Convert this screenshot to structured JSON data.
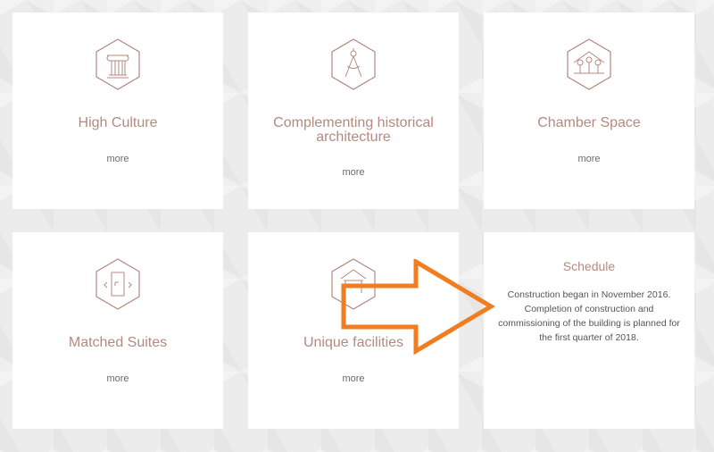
{
  "cards": [
    {
      "title": "High Culture",
      "more": "more",
      "icon": "column-icon"
    },
    {
      "title": "Complementing historical architecture",
      "more": "more",
      "icon": "compass-icon"
    },
    {
      "title": "Chamber Space",
      "more": "more",
      "icon": "house-trees-icon"
    },
    {
      "title": "Matched Suites",
      "more": "more",
      "icon": "door-icon"
    },
    {
      "title": "Unique facilities",
      "more": "more",
      "icon": "building-icon"
    }
  ],
  "schedule": {
    "title": "Schedule",
    "text": "Construction began in November 2016. Completion of construction and commissioning of the building is planned for the first quarter of 2018."
  },
  "colors": {
    "accent": "#b48a80",
    "arrow": "#f07d1f"
  }
}
